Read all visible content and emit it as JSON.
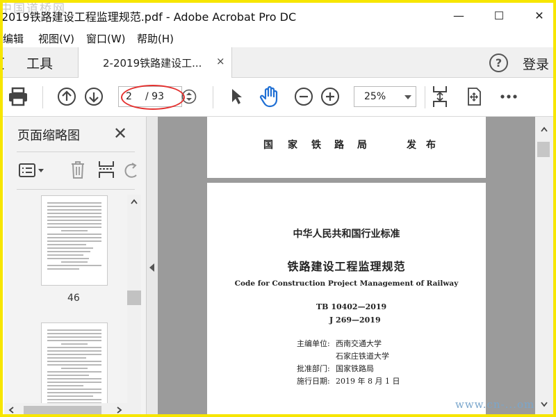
{
  "window": {
    "title": "2019铁路建设工程监理规范.pdf - Adobe Acrobat Pro DC",
    "watermark": "中国道桥网",
    "minimize": "—",
    "maximize": "☐",
    "close": "✕"
  },
  "menu": [
    "编辑",
    "视图(V)",
    "窗口(W)",
    "帮助(H)"
  ],
  "tabs": {
    "left_stub": "页",
    "tools": "工具",
    "document": "2-2019铁路建设工...",
    "close": "×",
    "login": "登录"
  },
  "toolbar": {
    "page_current": "2",
    "page_total": "/ 93",
    "zoom": "25%"
  },
  "left_panel": {
    "title": "页面缩略图",
    "thumbnails": [
      {
        "page_label": "46"
      }
    ]
  },
  "document": {
    "page1": {
      "publisher_chars": [
        "国",
        "家",
        "铁",
        "路",
        "局"
      ],
      "publish_word": "发布"
    },
    "page2": {
      "category": "中华人民共和国行业标准",
      "title": "铁路建设工程监理规范",
      "title_en": "Code for Construction Project Management of Railway",
      "code1": "TB 10402—2019",
      "code2": "J 269—2019",
      "chief_editor_label": "主编单位:",
      "chief_editor_1": "西南交通大学",
      "chief_editor_2": "石家庄铁道大学",
      "approval_label": "批准部门:",
      "approval": "国家铁路局",
      "effective_label": "施行日期:",
      "effective": "2019 年 8 月 1 日"
    }
  },
  "site_watermark": "www.cn-...om",
  "colors": {
    "frame": "#f7e600",
    "annotation": "#e4312f",
    "doc_background": "#9b9b9b"
  }
}
